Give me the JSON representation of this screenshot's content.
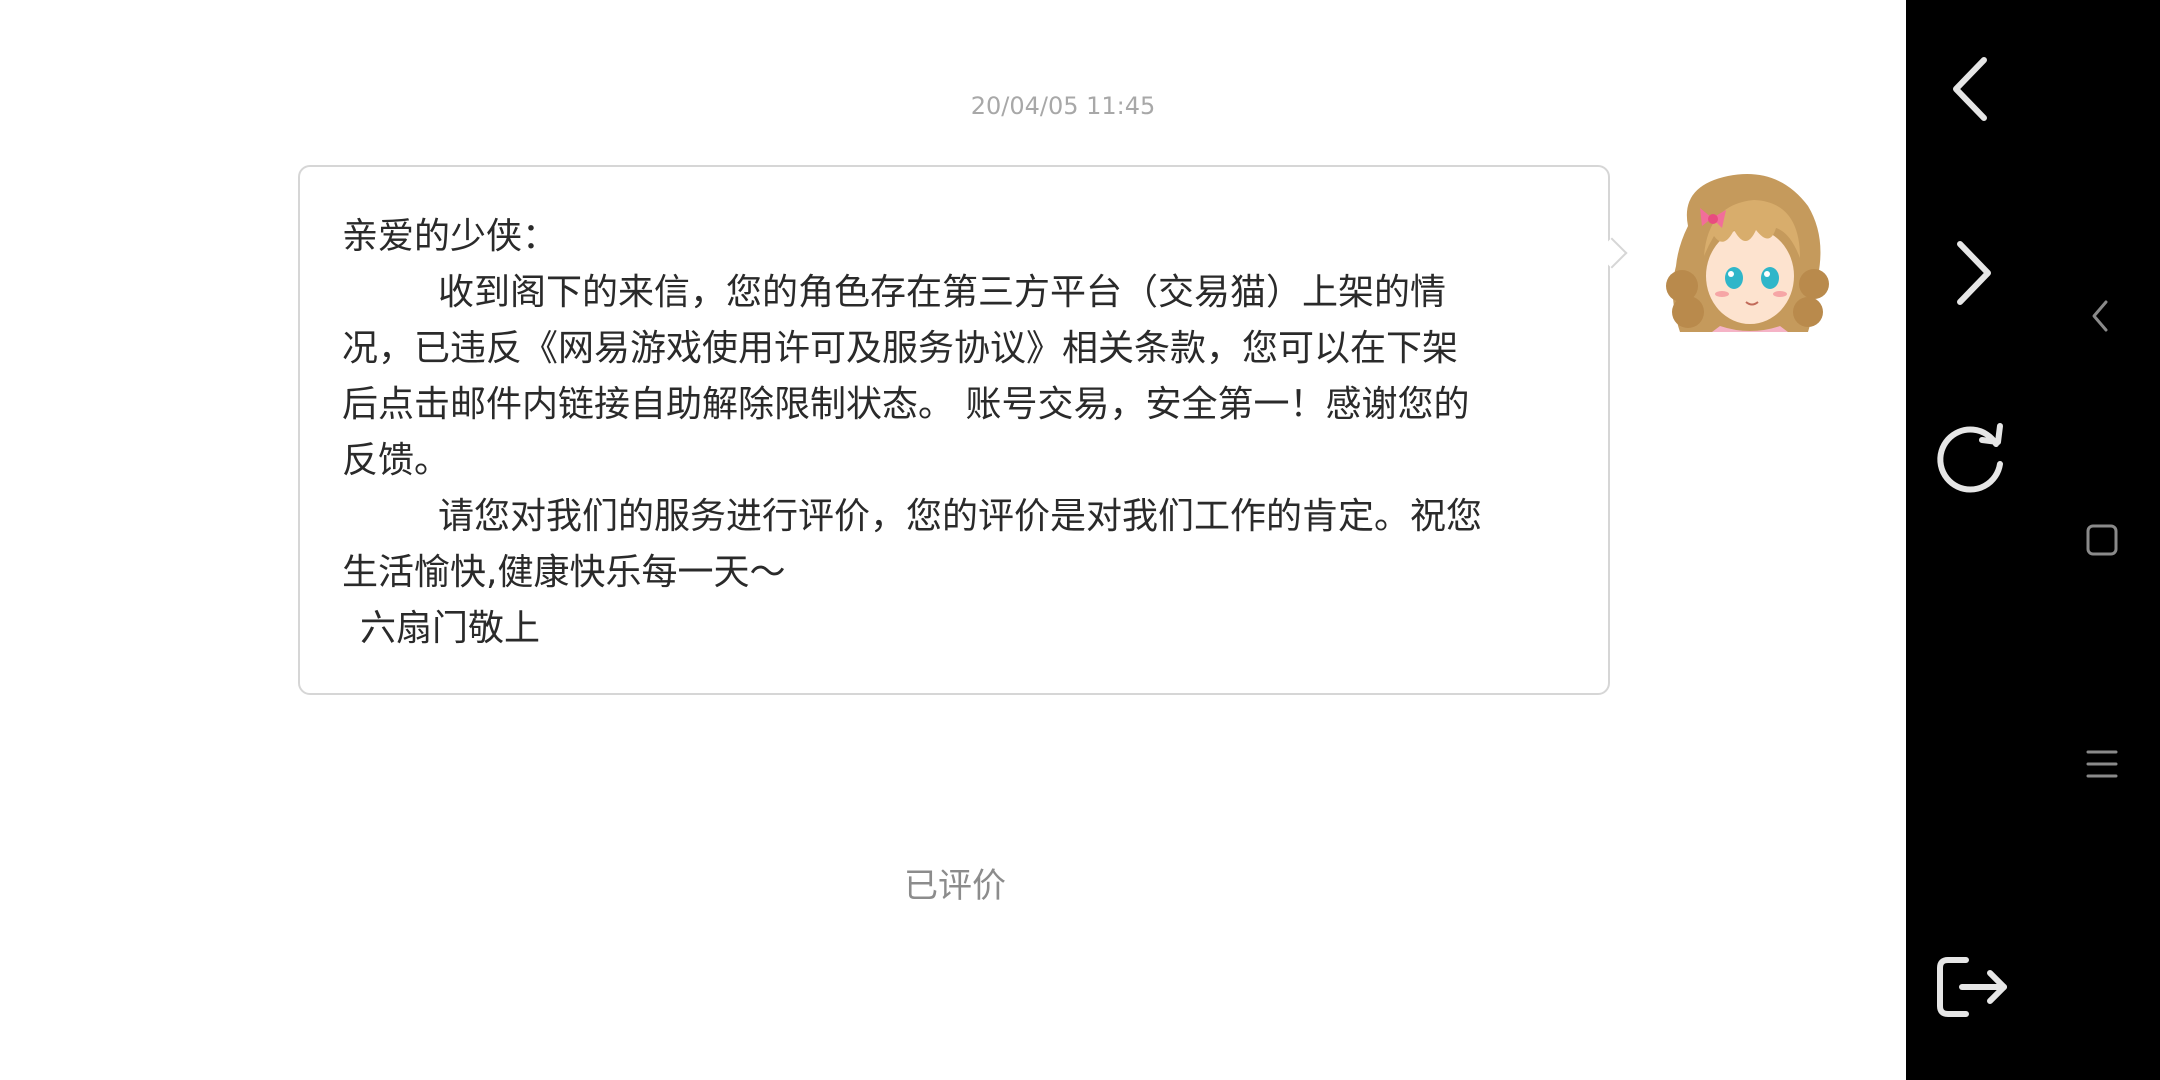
{
  "chat": {
    "timestamp": "20/04/05 11:45",
    "message": {
      "greeting": "亲爱的少侠：",
      "lines": [
        "收到阁下的来信，您的角色存在第三方平台（交易猫）上架的情",
        "况，已违反《网易游戏使用许可及服务协议》相关条款，您可以在下架",
        "后点击邮件内链接自助解除限制状态。 账号交易，安全第一！感谢您的",
        "反馈。",
        "请您对我们的服务进行评价，您的评价是对我们工作的肯定。祝您",
        "生活愉快,健康快乐每一天～",
        "六扇门敬上"
      ]
    },
    "rating_status": "已评价"
  },
  "colors": {
    "nav_background": "#000000",
    "nav_icon_primary": "#e6e6e6",
    "nav_icon_secondary": "#8a8a8a",
    "bubble_border": "#d6d6d6",
    "timestamp_text": "#a8a8a8"
  },
  "icons": {
    "back": "chevron-left-icon",
    "forward": "chevron-right-icon",
    "refresh": "refresh-icon",
    "exit": "exit-icon",
    "system_back": "system-back-icon",
    "system_home": "system-home-icon",
    "system_menu": "system-menu-icon"
  }
}
